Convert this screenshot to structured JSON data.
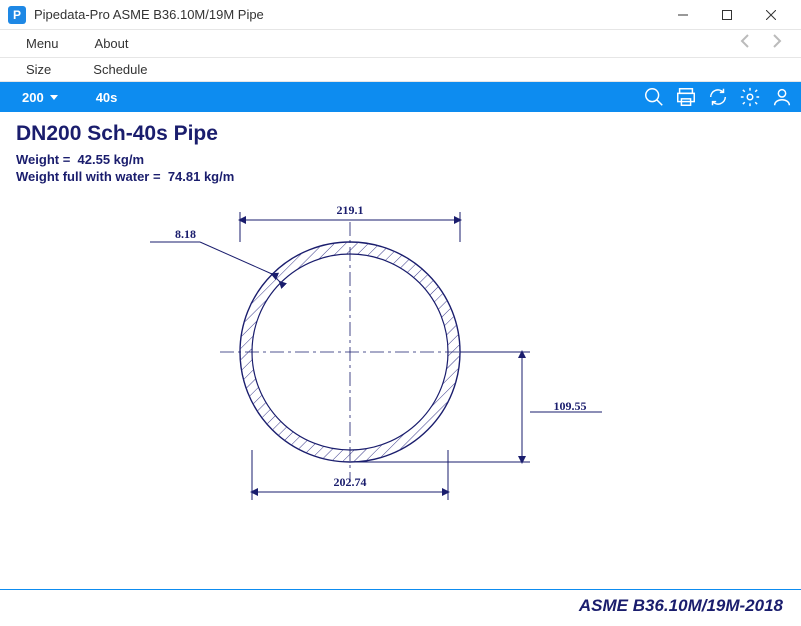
{
  "window": {
    "app_icon_letter": "P",
    "title": "Pipedata-Pro   ASME B36.10M/19M Pipe"
  },
  "menu": {
    "menu_label": "Menu",
    "about_label": "About"
  },
  "labels": {
    "size": "Size",
    "schedule": "Schedule"
  },
  "toolbar": {
    "size_value": "200",
    "schedule_value": "40s"
  },
  "main": {
    "heading": "DN200  Sch-40s Pipe",
    "weight_label": "Weight =",
    "weight_value": "42.55 kg/m",
    "weight_full_label": "Weight full with water =",
    "weight_full_value": "74.81 kg/m"
  },
  "dimensions": {
    "outer_diameter": "219.1",
    "inner_diameter": "202.74",
    "wall_thickness": "8.18",
    "radius": "109.55"
  },
  "footer": {
    "standard": "ASME B36.10M/19M-2018"
  }
}
